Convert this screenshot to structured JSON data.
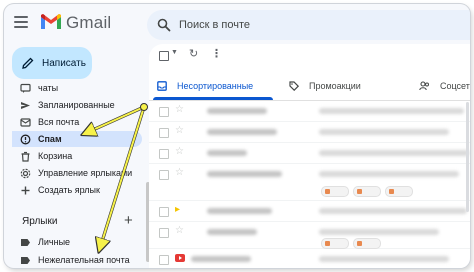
{
  "app": {
    "name": "Gmail",
    "brand_colors": [
      "#ea4335",
      "#4285f4",
      "#34a853",
      "#fbbc04",
      "#c5221f"
    ]
  },
  "search": {
    "placeholder": "Поиск в почте"
  },
  "compose": {
    "label": "Написать",
    "icon": "pencil-icon"
  },
  "sidebar": {
    "items": [
      {
        "label": "чаты",
        "icon": "chat-icon",
        "active": false
      },
      {
        "label": "Запланированные",
        "icon": "schedule-send-icon",
        "active": false
      },
      {
        "label": "Вся почта",
        "icon": "all-mail-icon",
        "active": false
      },
      {
        "label": "Спам",
        "icon": "report-spam-icon",
        "active": true
      },
      {
        "label": "Корзина",
        "icon": "trash-icon",
        "active": false
      },
      {
        "label": "Управление ярлыками",
        "icon": "settings-icon",
        "active": false
      },
      {
        "label": "Создать ярлык",
        "icon": "plus-icon",
        "active": false
      }
    ],
    "labels_heading": "Ярлыки",
    "labels_add": "+",
    "labels": [
      {
        "label": "Личные",
        "icon": "label-icon"
      },
      {
        "label": "Нежелательная почта",
        "icon": "label-icon"
      }
    ]
  },
  "toolbar": {
    "select_all": "checkbox",
    "refresh": "↻",
    "more": "⋮"
  },
  "tabs": [
    {
      "label": "Несортированные",
      "icon": "inbox-icon",
      "active": true
    },
    {
      "label": "Промоакции",
      "icon": "tag-icon",
      "active": false
    },
    {
      "label": "Соцсети",
      "icon": "people-icon",
      "active": false
    }
  ],
  "colors": {
    "accent": "#0b57d0",
    "compose_bg": "#c2e7ff",
    "active_item": "#d3e3fd",
    "annotation": "#f7f24a"
  },
  "rows_count": 8
}
